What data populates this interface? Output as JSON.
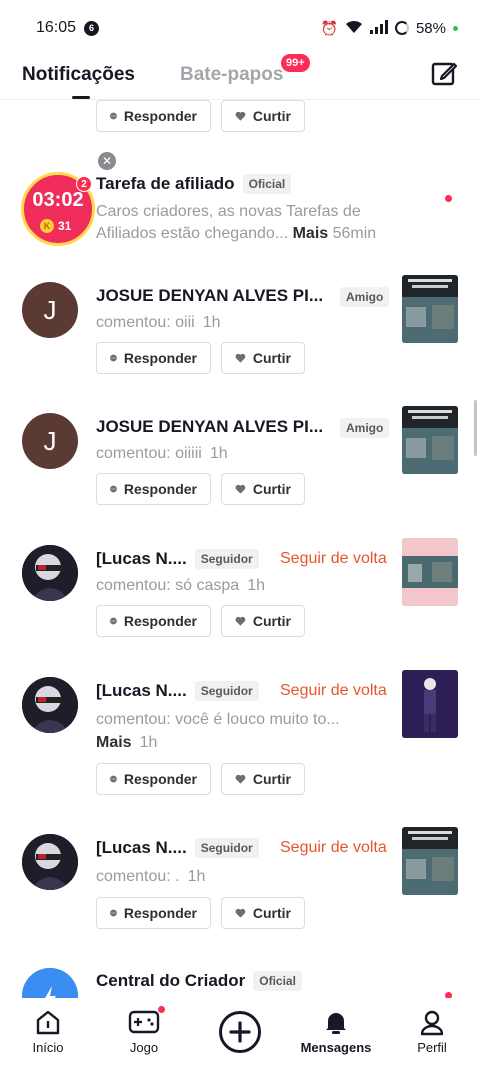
{
  "status_bar": {
    "time": "16:05",
    "notif_count": "6",
    "battery": "58%"
  },
  "header": {
    "tab_notifications": "Notificações",
    "tab_chats": "Bate-papos",
    "chats_badge": "99+"
  },
  "common": {
    "reply": "Responder",
    "like": "Curtir"
  },
  "affiliate": {
    "timer": "03:02",
    "coins": "31",
    "badge": "2",
    "name": "Tarefa de afiliado",
    "tag": "Oficial",
    "line1": "Caros criadores, as novas Tarefas de",
    "line2": "Afiliados estão chegando...",
    "more": "Mais",
    "time": "56min"
  },
  "items": [
    {
      "initial": "J",
      "name": "JOSUE DENYAN ALVES PI...",
      "tag": "Amigo",
      "text": "comentou: oiii",
      "time": "1h"
    },
    {
      "initial": "J",
      "name": "JOSUE DENYAN ALVES PI...",
      "tag": "Amigo",
      "text": "comentou: oiiiii",
      "time": "1h"
    },
    {
      "name": "[Lucas N....",
      "tag": "Seguidor",
      "follow": "Seguir de volta",
      "text": "comentou: só caspa",
      "time": "1h"
    },
    {
      "name": "[Lucas N....",
      "tag": "Seguidor",
      "follow": "Seguir de volta",
      "text": "comentou: você é louco muito to...",
      "more": "Mais",
      "time": "1h"
    },
    {
      "name": "[Lucas N....",
      "tag": "Seguidor",
      "follow": "Seguir de volta",
      "text": "comentou: .",
      "time": "1h"
    }
  ],
  "creator": {
    "name": "Central do Criador",
    "tag": "Oficial"
  },
  "nav": {
    "home": "Início",
    "game": "Jogo",
    "messages": "Mensagens",
    "profile": "Perfil"
  },
  "colors": {
    "accent": "#fe2c55",
    "follow": "#e8552d",
    "muted": "#9a9ba0"
  }
}
